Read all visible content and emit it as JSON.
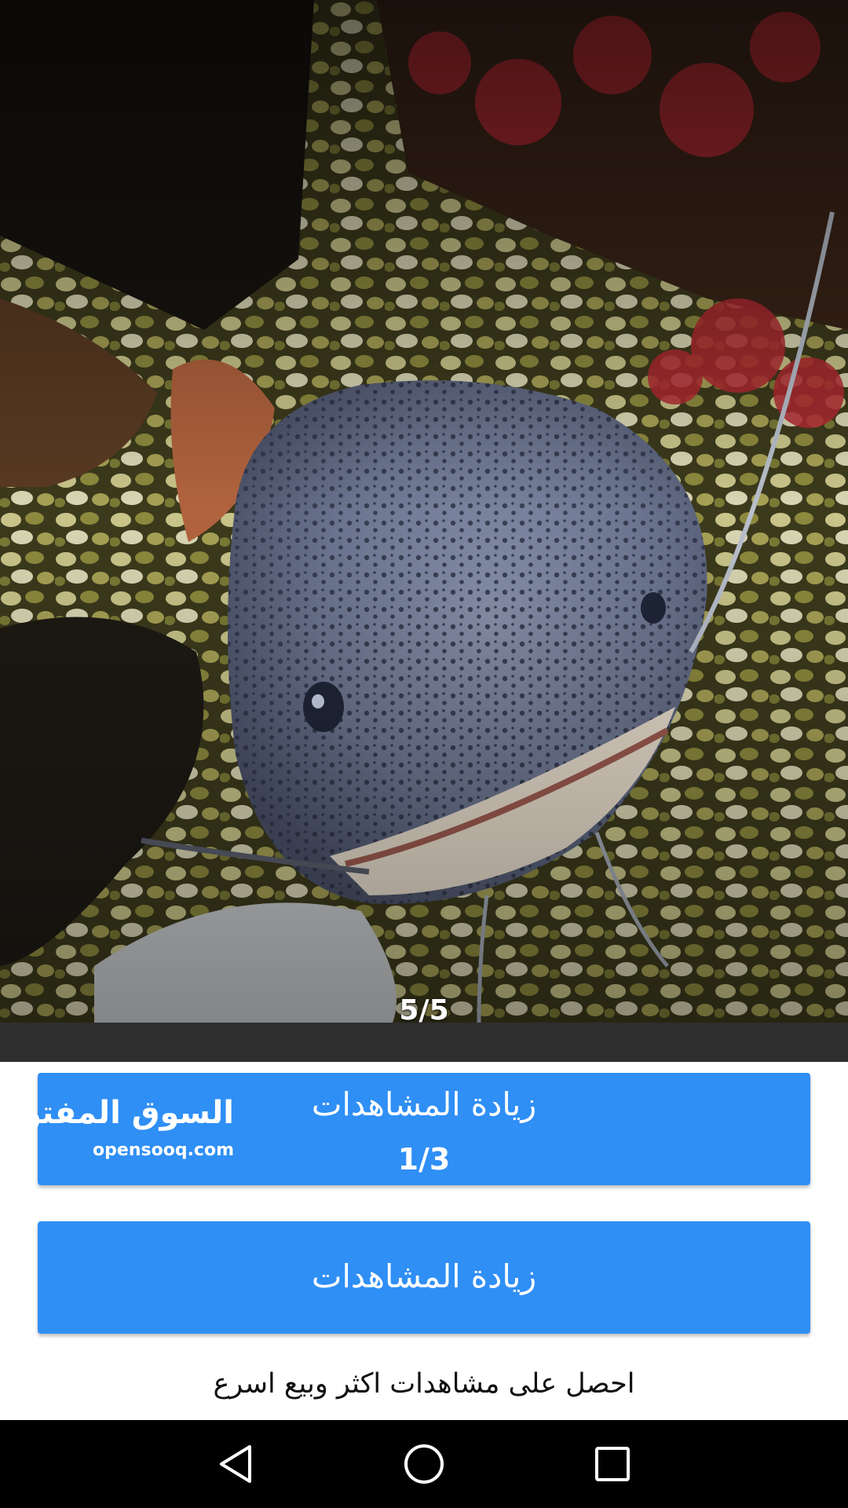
{
  "gallery": {
    "counter": "5/5"
  },
  "buttons": {
    "boost_views_with_count": {
      "label": "زيادة المشاهدات",
      "sub_label": "1/3"
    },
    "boost_views": {
      "label": "زيادة المشاهدات"
    }
  },
  "watermark": {
    "arabic": "السوق المفتوح",
    "english": "opensooq.com"
  },
  "hint_text": "احصل على مشاهدات اكثر وبيع اسرع",
  "navigation": {
    "back_icon": "back-triangle-icon",
    "home_icon": "home-circle-icon",
    "recents_icon": "recents-square-icon"
  },
  "colors": {
    "button_blue": "#2f8ff5",
    "nav_bar": "#000000",
    "strip": "#2e2e2e"
  }
}
